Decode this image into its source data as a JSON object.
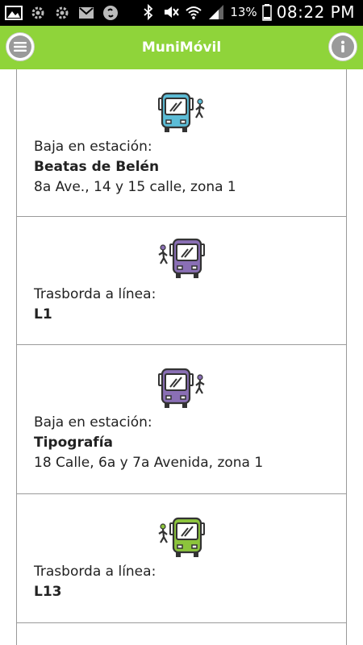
{
  "status_bar": {
    "battery": "13%",
    "time": "08:22 PM"
  },
  "app_bar": {
    "title": "MuniMóvil",
    "menu_icon": "menu-icon",
    "info_icon": "info-icon"
  },
  "steps": [
    {
      "icon": "bus-walk-off-icon",
      "bus_color": "#5bbcd6",
      "label": "Baja en estación:",
      "title": "Beatas de Belén",
      "detail": "8a Ave., 14 y 15 calle, zona 1"
    },
    {
      "icon": "walk-bus-transfer-icon",
      "bus_color": "#8a6fb5",
      "label": "Trasborda a línea:",
      "title": "L1",
      "detail": ""
    },
    {
      "icon": "bus-walk-off-icon",
      "bus_color": "#8a6fb5",
      "label": "Baja en estación:",
      "title": "Tipografía",
      "detail": "18 Calle, 6a y 7a Avenida, zona 1"
    },
    {
      "icon": "walk-bus-transfer-icon",
      "bus_color": "#8cc43c",
      "label": "Trasborda a línea:",
      "title": "L13",
      "detail": ""
    }
  ]
}
